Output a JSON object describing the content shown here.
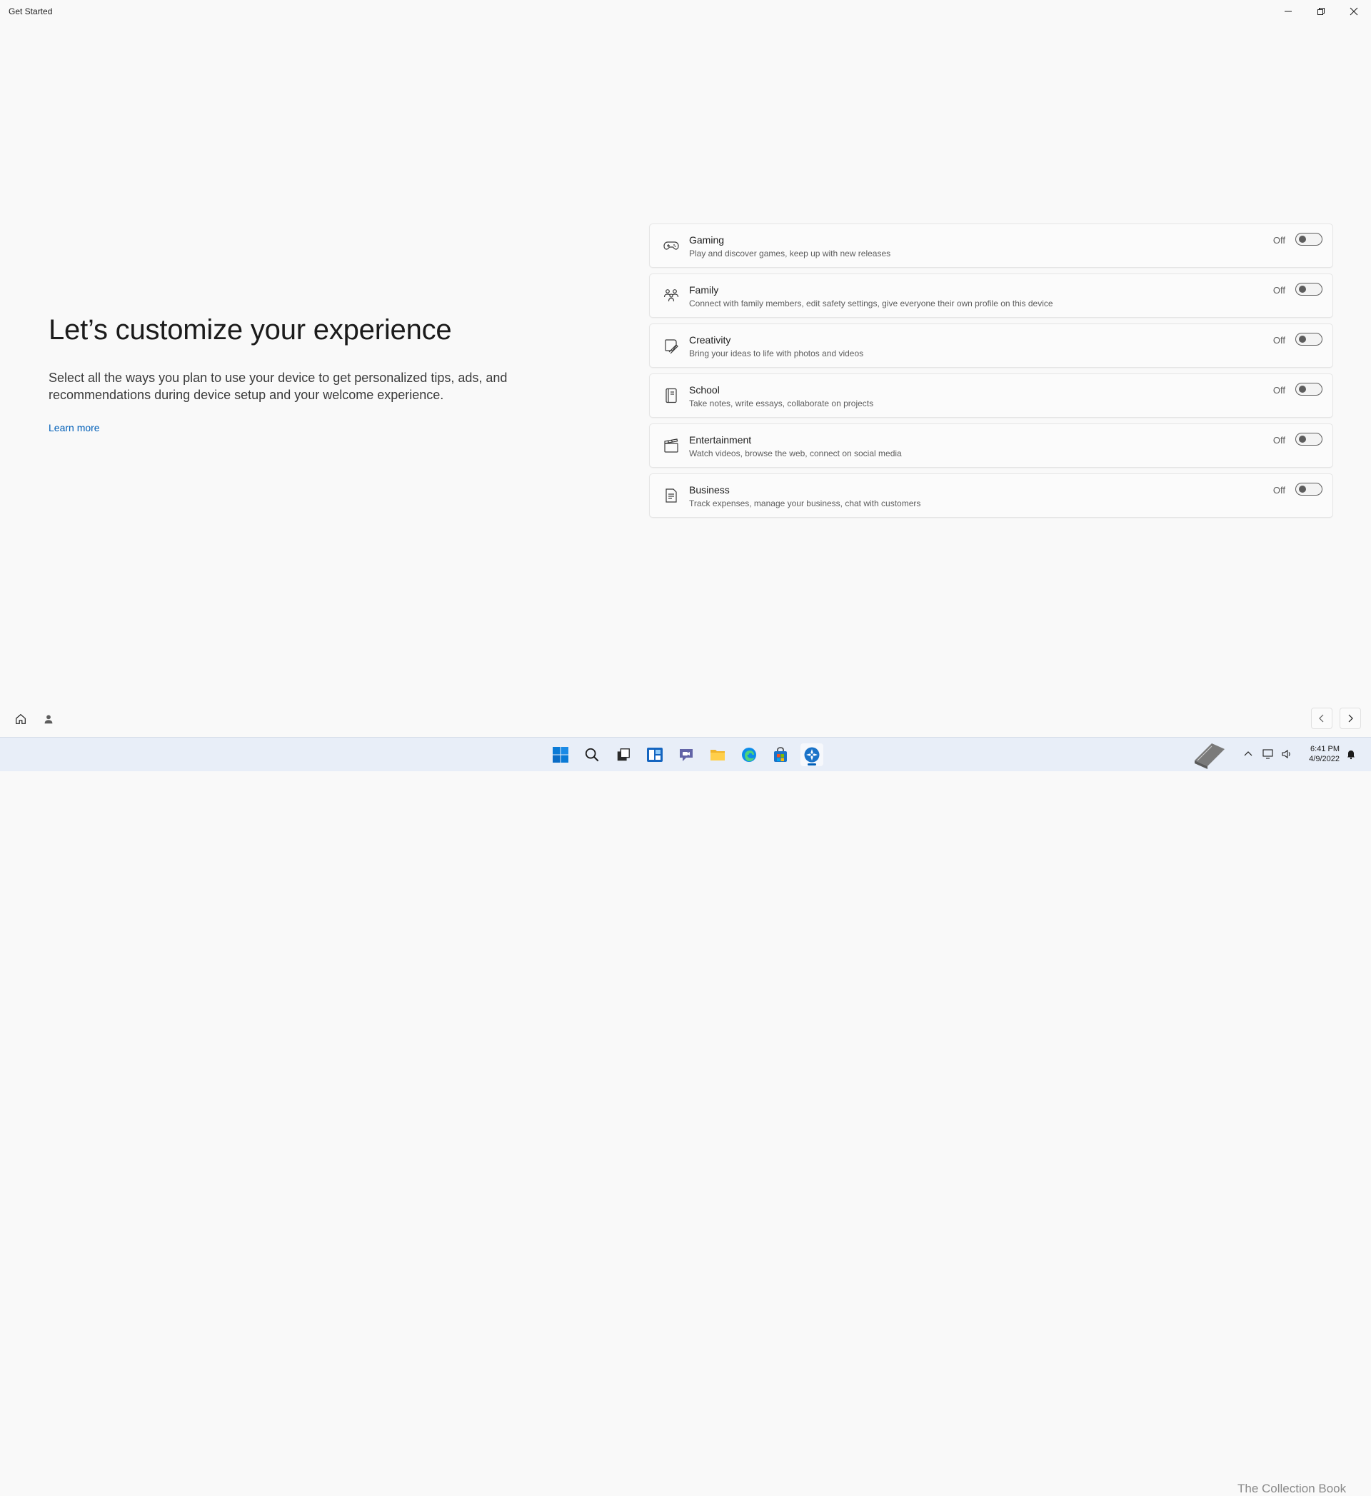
{
  "window": {
    "title": "Get Started"
  },
  "left": {
    "heading": "Let’s customize your experience",
    "description": "Select all the ways you plan to use your device to get personalized tips, ads, and recommendations during device setup and your welcome experience.",
    "learn_more": "Learn more"
  },
  "options": [
    {
      "label": "Gaming",
      "description": "Play and discover games, keep up with new releases",
      "state": "Off",
      "icon": "gamepad-icon"
    },
    {
      "label": "Family",
      "description": "Connect with family members, edit safety settings, give everyone their own profile on this device",
      "state": "Off",
      "icon": "family-icon"
    },
    {
      "label": "Creativity",
      "description": "Bring your ideas to life with photos and videos",
      "state": "Off",
      "icon": "pen-icon"
    },
    {
      "label": "School",
      "description": "Take notes, write essays, collaborate on projects",
      "state": "Off",
      "icon": "notebook-icon"
    },
    {
      "label": "Entertainment",
      "description": "Watch videos, browse the web, connect on social media",
      "state": "Off",
      "icon": "clapperboard-icon"
    },
    {
      "label": "Business",
      "description": "Track expenses, manage your business, chat with customers",
      "state": "Off",
      "icon": "document-icon"
    }
  ],
  "taskbar": {
    "icons": [
      "start-icon",
      "search-icon",
      "task-view-icon",
      "widgets-icon",
      "chat-icon",
      "file-explorer-icon",
      "edge-icon",
      "store-icon",
      "get-started-icon"
    ],
    "watermark": "The Collection Book",
    "time": "6:41 PM",
    "date": "4/9/2022"
  },
  "colors": {
    "accent": "#005fb8",
    "background": "#f9f9f9",
    "taskbar": "#e8eef8"
  }
}
